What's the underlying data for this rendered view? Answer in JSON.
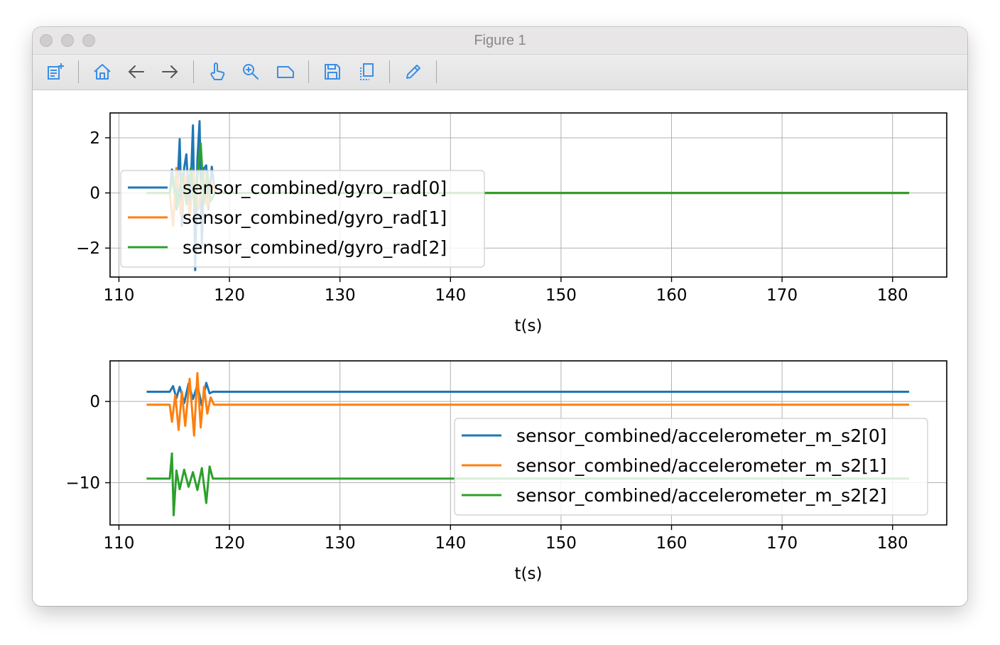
{
  "window": {
    "title": "Figure 1",
    "traffic_lights": [
      "close-button",
      "minimize-button",
      "zoom-button"
    ]
  },
  "toolbar": {
    "icon_color": "#3a8ee6",
    "buttons": [
      {
        "name": "subplots-config-icon"
      },
      {
        "name": "home-icon"
      },
      {
        "name": "back-arrow-icon"
      },
      {
        "name": "forward-arrow-icon"
      },
      {
        "name": "pan-hand-icon"
      },
      {
        "name": "zoom-magnifier-icon"
      },
      {
        "name": "zoom-rect-icon"
      },
      {
        "name": "save-icon"
      },
      {
        "name": "copy-icon"
      },
      {
        "name": "edit-pencil-icon"
      }
    ]
  },
  "chart_data": [
    {
      "type": "line",
      "xlabel": "t(s)",
      "ylabel": "",
      "xlim": [
        109.2,
        184.9
      ],
      "ylim": [
        -3.05,
        2.9
      ],
      "xticks": [
        110,
        120,
        130,
        140,
        150,
        160,
        170,
        180
      ],
      "yticks": [
        2,
        0,
        -2
      ],
      "ytick_labels": [
        "2",
        "0",
        "−2"
      ],
      "grid": true,
      "legend_position": "upper-left",
      "series": [
        {
          "name": "sensor_combined/gyro_rad[0]",
          "color": "#1f77b4",
          "x": [
            112.5,
            114.6,
            114.8,
            115.2,
            115.5,
            115.7,
            115.9,
            116.1,
            116.4,
            116.7,
            116.9,
            117.1,
            117.3,
            117.5,
            117.7,
            117.9,
            118.1,
            118.4,
            118.7,
            130,
            147,
            160,
            181.5
          ],
          "y": [
            0,
            0,
            0.85,
            -0.6,
            1.95,
            -1.2,
            0.9,
            1.4,
            -0.8,
            2.45,
            -2.8,
            1.2,
            2.6,
            -1.9,
            0.9,
            1.0,
            -0.6,
            0.95,
            0,
            0,
            0,
            0,
            0
          ]
        },
        {
          "name": "sensor_combined/gyro_rad[1]",
          "color": "#ff7f0e",
          "x": [
            112.5,
            114.6,
            114.9,
            115.2,
            115.6,
            116.0,
            116.4,
            116.8,
            117.2,
            117.6,
            118.0,
            118.4,
            118.7,
            130,
            147,
            160,
            181.5
          ],
          "y": [
            0,
            0,
            -1.2,
            0.9,
            -0.8,
            0.6,
            -0.9,
            0.7,
            -0.6,
            0.8,
            -0.5,
            0.4,
            0,
            0,
            0,
            0,
            0
          ]
        },
        {
          "name": "sensor_combined/gyro_rad[2]",
          "color": "#2ca02c",
          "x": [
            112.5,
            114.6,
            114.9,
            115.3,
            115.7,
            116.1,
            116.5,
            116.9,
            117.2,
            117.4,
            117.7,
            118.0,
            118.3,
            118.7,
            130,
            147,
            160,
            181.5
          ],
          "y": [
            0,
            0,
            0.6,
            -0.5,
            0.7,
            -0.4,
            0.9,
            -0.6,
            1.0,
            1.8,
            -0.4,
            0.8,
            -0.3,
            0,
            0,
            0,
            0,
            0
          ]
        }
      ]
    },
    {
      "type": "line",
      "xlabel": "t(s)",
      "ylabel": "",
      "xlim": [
        109.2,
        184.9
      ],
      "ylim": [
        -15.2,
        5.0
      ],
      "xticks": [
        110,
        120,
        130,
        140,
        150,
        160,
        170,
        180
      ],
      "yticks": [
        0,
        -10
      ],
      "ytick_labels": [
        "0",
        "−10"
      ],
      "grid": true,
      "legend_position": "lower-right",
      "series": [
        {
          "name": "sensor_combined/accelerometer_m_s2[0]",
          "color": "#1f77b4",
          "x": [
            112.5,
            114.6,
            114.9,
            115.2,
            115.5,
            115.9,
            116.3,
            116.7,
            117.1,
            117.5,
            117.9,
            118.2,
            118.5,
            130,
            147,
            160,
            181.5
          ],
          "y": [
            1.2,
            1.2,
            1.9,
            0.4,
            1.8,
            -0.2,
            2.2,
            0.3,
            2.0,
            -0.5,
            2.3,
            1.0,
            1.2,
            1.2,
            1.2,
            1.2,
            1.2
          ]
        },
        {
          "name": "sensor_combined/accelerometer_m_s2[1]",
          "color": "#ff7f0e",
          "x": [
            112.5,
            114.6,
            114.8,
            115.1,
            115.4,
            115.7,
            116.0,
            116.4,
            116.8,
            117.1,
            117.4,
            117.7,
            118.0,
            118.3,
            118.6,
            130,
            147,
            160,
            181.5
          ],
          "y": [
            -0.4,
            -0.4,
            -2.5,
            0.8,
            -3.5,
            1.2,
            -3.0,
            2.8,
            -4.2,
            3.5,
            -3.2,
            1.8,
            -1.5,
            0.5,
            -0.4,
            -0.4,
            -0.4,
            -0.4,
            -0.4
          ]
        },
        {
          "name": "sensor_combined/accelerometer_m_s2[2]",
          "color": "#2ca02c",
          "x": [
            112.5,
            114.6,
            114.8,
            114.95,
            115.2,
            115.5,
            115.9,
            116.3,
            116.7,
            117.1,
            117.5,
            117.9,
            118.2,
            118.5,
            130,
            147,
            160,
            181.5
          ],
          "y": [
            -9.5,
            -9.5,
            -6.4,
            -14.0,
            -8.5,
            -10.8,
            -8.4,
            -10.5,
            -8.7,
            -10.9,
            -8.2,
            -12.5,
            -8.0,
            -9.5,
            -9.5,
            -9.5,
            -9.5,
            -9.5
          ]
        }
      ]
    }
  ]
}
